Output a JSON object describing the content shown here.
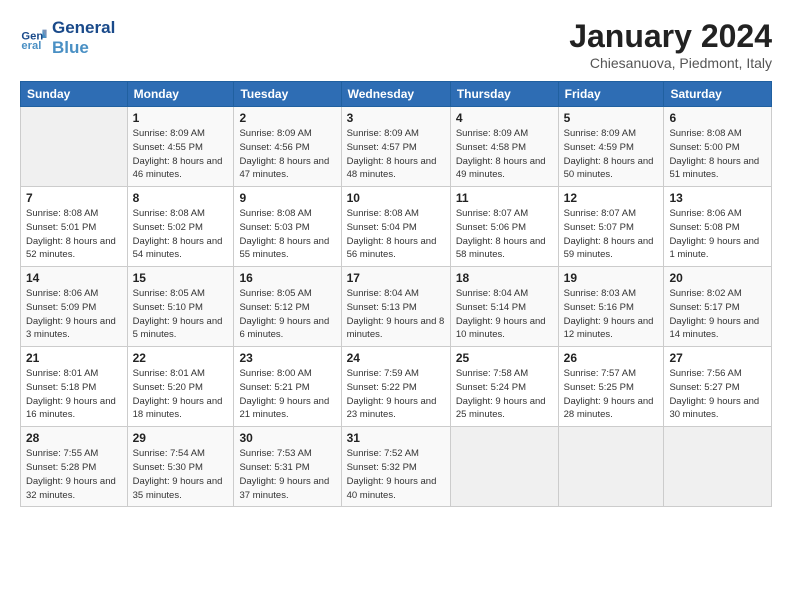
{
  "header": {
    "logo": {
      "line1": "General",
      "line2": "Blue"
    },
    "title": "January 2024",
    "location": "Chiesanuova, Piedmont, Italy"
  },
  "weekdays": [
    "Sunday",
    "Monday",
    "Tuesday",
    "Wednesday",
    "Thursday",
    "Friday",
    "Saturday"
  ],
  "weeks": [
    [
      null,
      {
        "day": 1,
        "sunrise": "8:09 AM",
        "sunset": "4:55 PM",
        "daylight": "8 hours and 46 minutes."
      },
      {
        "day": 2,
        "sunrise": "8:09 AM",
        "sunset": "4:56 PM",
        "daylight": "8 hours and 47 minutes."
      },
      {
        "day": 3,
        "sunrise": "8:09 AM",
        "sunset": "4:57 PM",
        "daylight": "8 hours and 48 minutes."
      },
      {
        "day": 4,
        "sunrise": "8:09 AM",
        "sunset": "4:58 PM",
        "daylight": "8 hours and 49 minutes."
      },
      {
        "day": 5,
        "sunrise": "8:09 AM",
        "sunset": "4:59 PM",
        "daylight": "8 hours and 50 minutes."
      },
      {
        "day": 6,
        "sunrise": "8:08 AM",
        "sunset": "5:00 PM",
        "daylight": "8 hours and 51 minutes."
      }
    ],
    [
      {
        "day": 7,
        "sunrise": "8:08 AM",
        "sunset": "5:01 PM",
        "daylight": "8 hours and 52 minutes."
      },
      {
        "day": 8,
        "sunrise": "8:08 AM",
        "sunset": "5:02 PM",
        "daylight": "8 hours and 54 minutes."
      },
      {
        "day": 9,
        "sunrise": "8:08 AM",
        "sunset": "5:03 PM",
        "daylight": "8 hours and 55 minutes."
      },
      {
        "day": 10,
        "sunrise": "8:08 AM",
        "sunset": "5:04 PM",
        "daylight": "8 hours and 56 minutes."
      },
      {
        "day": 11,
        "sunrise": "8:07 AM",
        "sunset": "5:06 PM",
        "daylight": "8 hours and 58 minutes."
      },
      {
        "day": 12,
        "sunrise": "8:07 AM",
        "sunset": "5:07 PM",
        "daylight": "8 hours and 59 minutes."
      },
      {
        "day": 13,
        "sunrise": "8:06 AM",
        "sunset": "5:08 PM",
        "daylight": "9 hours and 1 minute."
      }
    ],
    [
      {
        "day": 14,
        "sunrise": "8:06 AM",
        "sunset": "5:09 PM",
        "daylight": "9 hours and 3 minutes."
      },
      {
        "day": 15,
        "sunrise": "8:05 AM",
        "sunset": "5:10 PM",
        "daylight": "9 hours and 5 minutes."
      },
      {
        "day": 16,
        "sunrise": "8:05 AM",
        "sunset": "5:12 PM",
        "daylight": "9 hours and 6 minutes."
      },
      {
        "day": 17,
        "sunrise": "8:04 AM",
        "sunset": "5:13 PM",
        "daylight": "9 hours and 8 minutes."
      },
      {
        "day": 18,
        "sunrise": "8:04 AM",
        "sunset": "5:14 PM",
        "daylight": "9 hours and 10 minutes."
      },
      {
        "day": 19,
        "sunrise": "8:03 AM",
        "sunset": "5:16 PM",
        "daylight": "9 hours and 12 minutes."
      },
      {
        "day": 20,
        "sunrise": "8:02 AM",
        "sunset": "5:17 PM",
        "daylight": "9 hours and 14 minutes."
      }
    ],
    [
      {
        "day": 21,
        "sunrise": "8:01 AM",
        "sunset": "5:18 PM",
        "daylight": "9 hours and 16 minutes."
      },
      {
        "day": 22,
        "sunrise": "8:01 AM",
        "sunset": "5:20 PM",
        "daylight": "9 hours and 18 minutes."
      },
      {
        "day": 23,
        "sunrise": "8:00 AM",
        "sunset": "5:21 PM",
        "daylight": "9 hours and 21 minutes."
      },
      {
        "day": 24,
        "sunrise": "7:59 AM",
        "sunset": "5:22 PM",
        "daylight": "9 hours and 23 minutes."
      },
      {
        "day": 25,
        "sunrise": "7:58 AM",
        "sunset": "5:24 PM",
        "daylight": "9 hours and 25 minutes."
      },
      {
        "day": 26,
        "sunrise": "7:57 AM",
        "sunset": "5:25 PM",
        "daylight": "9 hours and 28 minutes."
      },
      {
        "day": 27,
        "sunrise": "7:56 AM",
        "sunset": "5:27 PM",
        "daylight": "9 hours and 30 minutes."
      }
    ],
    [
      {
        "day": 28,
        "sunrise": "7:55 AM",
        "sunset": "5:28 PM",
        "daylight": "9 hours and 32 minutes."
      },
      {
        "day": 29,
        "sunrise": "7:54 AM",
        "sunset": "5:30 PM",
        "daylight": "9 hours and 35 minutes."
      },
      {
        "day": 30,
        "sunrise": "7:53 AM",
        "sunset": "5:31 PM",
        "daylight": "9 hours and 37 minutes."
      },
      {
        "day": 31,
        "sunrise": "7:52 AM",
        "sunset": "5:32 PM",
        "daylight": "9 hours and 40 minutes."
      },
      null,
      null,
      null
    ]
  ],
  "labels": {
    "sunrise": "Sunrise:",
    "sunset": "Sunset:",
    "daylight": "Daylight:"
  }
}
